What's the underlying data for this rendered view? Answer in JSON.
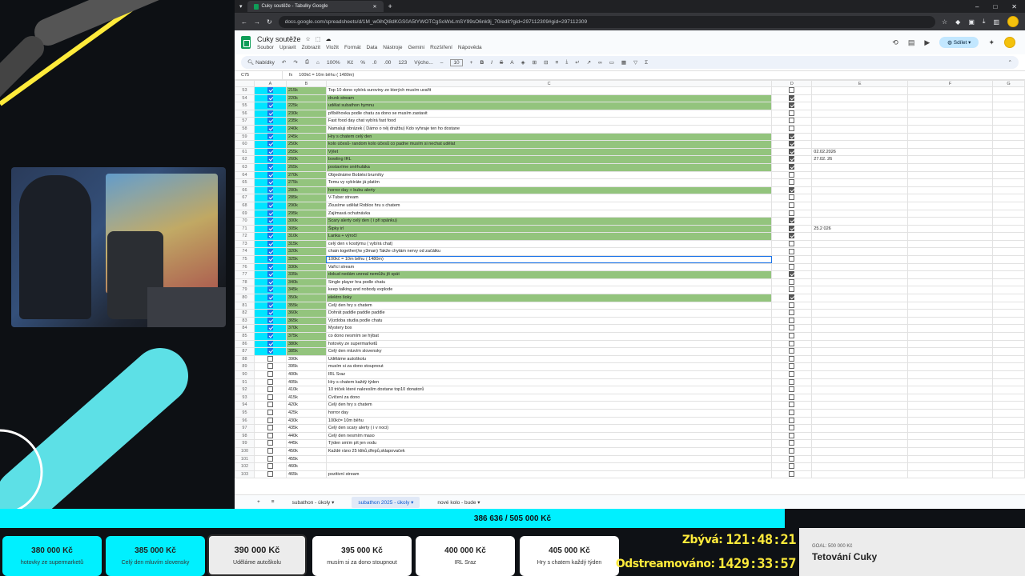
{
  "browser": {
    "tab_title": "Cuky soutěže - Tabulky Google",
    "url": "docs.google.com/spreadsheets/d/1M_w0ihQl8dKGS0A5tYWOTCgSoWxLmSY99sO6nk9j_70/edit?gid=297112309#gid=297112309"
  },
  "sheet": {
    "title": "Cuky soutěže",
    "menus": [
      "Soubor",
      "Upravit",
      "Zobrazit",
      "Vložit",
      "Formát",
      "Data",
      "Nástroje",
      "Gemini",
      "Rozšíření",
      "Nápověda"
    ],
    "share_label": "Sdílet",
    "toolbar": {
      "search": "Nabídky",
      "zoom": "100%",
      "currency": "Kč",
      "percent": "%",
      "decimals": ".0",
      "decimals2": ".00",
      "numfmt": "123",
      "font": "Výcho...",
      "font_size": "10"
    },
    "namebox": "C75",
    "formula": "100kč = 10m běhu ( 1480m)",
    "columns": [
      "",
      "A",
      "B",
      "C",
      "D",
      "E",
      "F",
      "G"
    ],
    "rows": [
      {
        "n": "53",
        "a": true,
        "b": "215k",
        "c": "Top 10 dono vybírá suroviny ze kterých musím uvařit",
        "g": false,
        "d": false,
        "e": ""
      },
      {
        "n": "54",
        "a": true,
        "b": "220k",
        "c": "drunk stream",
        "g": true,
        "d": true,
        "e": ""
      },
      {
        "n": "55",
        "a": true,
        "b": "225k",
        "c": "udělat subathon hymnu",
        "g": true,
        "d": true,
        "e": ""
      },
      {
        "n": "56",
        "a": true,
        "b": "230k",
        "c": "příběhovka podle chatu za dono se musím zastavit",
        "g": false,
        "d": false,
        "e": ""
      },
      {
        "n": "57",
        "a": true,
        "b": "235k",
        "c": "Fast food day chat vybírá fast food",
        "g": false,
        "d": false,
        "e": ""
      },
      {
        "n": "58",
        "a": true,
        "b": "240k",
        "c": "Namaluji obrázek ( Dámo o něj dražbu) Kdo vyhraje ten ho dostane",
        "g": false,
        "d": false,
        "e": ""
      },
      {
        "n": "59",
        "a": true,
        "b": "245k",
        "c": "Hry s chatem celý den",
        "g": true,
        "d": true,
        "e": ""
      },
      {
        "n": "60",
        "a": true,
        "b": "250k",
        "c": "kolo účesů- random kolo účesů co padne musím si nechat udělat",
        "g": true,
        "d": true,
        "e": ""
      },
      {
        "n": "61",
        "a": true,
        "b": "255k",
        "c": "Výlet",
        "g": true,
        "d": true,
        "e": "02.02.2026"
      },
      {
        "n": "62",
        "a": true,
        "b": "260k",
        "c": "bowling IRL",
        "g": true,
        "d": true,
        "e": "27.02. 26"
      },
      {
        "n": "63",
        "a": true,
        "b": "265k",
        "c": "postavíme sněhuláka",
        "g": true,
        "d": true,
        "e": ""
      },
      {
        "n": "64",
        "a": true,
        "b": "270k",
        "c": "Objednáme Bobiési brumíky",
        "g": false,
        "d": false,
        "e": ""
      },
      {
        "n": "65",
        "a": true,
        "b": "275k",
        "c": "Temu vy vybíráte já platím",
        "g": false,
        "d": false,
        "e": ""
      },
      {
        "n": "66",
        "a": true,
        "b": "280k",
        "c": "horror day + bubu alerty",
        "g": true,
        "d": true,
        "e": ""
      },
      {
        "n": "67",
        "a": true,
        "b": "285k",
        "c": "V-Tuber stream",
        "g": false,
        "d": false,
        "e": ""
      },
      {
        "n": "68",
        "a": true,
        "b": "290k",
        "c": "Zkusíme udělat Roblox hru s chatem",
        "g": false,
        "d": false,
        "e": ""
      },
      {
        "n": "69",
        "a": true,
        "b": "295k",
        "c": "Zajímavá ochutnávka",
        "g": false,
        "d": false,
        "e": ""
      },
      {
        "n": "70",
        "a": true,
        "b": "300k",
        "c": "Scary alerty celý den ( i při spánku)",
        "g": true,
        "d": true,
        "e": ""
      },
      {
        "n": "71",
        "a": true,
        "b": "305k",
        "c": "Šipky irl",
        "g": true,
        "d": true,
        "e": "25.2 026"
      },
      {
        "n": "72",
        "a": true,
        "b": "310k",
        "c": "Lanka + výročí",
        "g": true,
        "d": true,
        "e": ""
      },
      {
        "n": "73",
        "a": true,
        "b": "315k",
        "c": "celý den v kostýmu ( vybírá chat)",
        "g": false,
        "d": false,
        "e": ""
      },
      {
        "n": "74",
        "a": true,
        "b": "320k",
        "c": "chain together(/w y3man) Takže chytám nervy od začátku",
        "g": false,
        "d": false,
        "e": ""
      },
      {
        "n": "75",
        "a": true,
        "b": "325k",
        "c": "100kč = 10m běhu ( 1480m)",
        "g": false,
        "d": false,
        "e": "",
        "sel": true
      },
      {
        "n": "76",
        "a": true,
        "b": "330k",
        "c": "Vařící stream",
        "g": false,
        "d": false,
        "e": ""
      },
      {
        "n": "77",
        "a": true,
        "b": "335k",
        "c": "dokud nedám unreal nemůžu jít spát",
        "g": true,
        "d": true,
        "e": ""
      },
      {
        "n": "78",
        "a": true,
        "b": "340k",
        "c": "Single player hra podle chatu",
        "g": false,
        "d": false,
        "e": ""
      },
      {
        "n": "79",
        "a": true,
        "b": "345k",
        "c": "keep talking and nobody explode",
        "g": false,
        "d": false,
        "e": ""
      },
      {
        "n": "80",
        "a": true,
        "b": "350k",
        "c": "elektro šoky",
        "g": true,
        "d": true,
        "e": ""
      },
      {
        "n": "81",
        "a": true,
        "b": "355k",
        "c": "Celý den hry s chatem",
        "g": false,
        "d": false,
        "e": ""
      },
      {
        "n": "82",
        "a": true,
        "b": "360k",
        "c": "Dohrát paddle paddle paddle",
        "g": false,
        "d": false,
        "e": ""
      },
      {
        "n": "83",
        "a": true,
        "b": "365k",
        "c": "Výzdoba studia podle chatu",
        "g": false,
        "d": false,
        "e": ""
      },
      {
        "n": "84",
        "a": true,
        "b": "370k",
        "c": "Mystery box",
        "g": false,
        "d": false,
        "e": ""
      },
      {
        "n": "85",
        "a": true,
        "b": "375k",
        "c": "co dono nesmím se hýbat",
        "g": false,
        "d": false,
        "e": ""
      },
      {
        "n": "86",
        "a": true,
        "b": "380k",
        "c": "hotovky ze supermarketů",
        "g": false,
        "d": false,
        "e": ""
      },
      {
        "n": "87",
        "a": true,
        "b": "385k",
        "c": "Celý den mluvím slovensky",
        "g": false,
        "d": false,
        "e": ""
      },
      {
        "n": "88",
        "a": false,
        "b": "390k",
        "c": "Uděláme autoškolu",
        "g": false,
        "d": false,
        "e": ""
      },
      {
        "n": "89",
        "a": false,
        "b": "395k",
        "c": "musím si za dono stoupnout",
        "g": false,
        "d": false,
        "e": ""
      },
      {
        "n": "90",
        "a": false,
        "b": "400k",
        "c": "IRL Sraz",
        "g": false,
        "d": false,
        "e": ""
      },
      {
        "n": "91",
        "a": false,
        "b": "405k",
        "c": "Hry s chatem každý týden",
        "g": false,
        "d": false,
        "e": ""
      },
      {
        "n": "92",
        "a": false,
        "b": "410k",
        "c": "10 triček které nakreslím dostane top10 donatorů",
        "g": false,
        "d": false,
        "e": ""
      },
      {
        "n": "93",
        "a": false,
        "b": "415k",
        "c": "Cvičení za dono",
        "g": false,
        "d": false,
        "e": ""
      },
      {
        "n": "94",
        "a": false,
        "b": "420k",
        "c": "Celý den hry s chatem",
        "g": false,
        "d": false,
        "e": ""
      },
      {
        "n": "95",
        "a": false,
        "b": "425k",
        "c": "horror day",
        "g": false,
        "d": false,
        "e": ""
      },
      {
        "n": "96",
        "a": false,
        "b": "430k",
        "c": "100kč= 10m běhu",
        "g": false,
        "d": false,
        "e": ""
      },
      {
        "n": "97",
        "a": false,
        "b": "435k",
        "c": "Celý den scary alerty ( i v noci)",
        "g": false,
        "d": false,
        "e": ""
      },
      {
        "n": "98",
        "a": false,
        "b": "440k",
        "c": "Celý den nesmím maso",
        "g": false,
        "d": false,
        "e": ""
      },
      {
        "n": "99",
        "a": false,
        "b": "445k",
        "c": "Týden smím pít jen vodu",
        "g": false,
        "d": false,
        "e": ""
      },
      {
        "n": "100",
        "a": false,
        "b": "450k",
        "c": "Každé ráno 25 kliků,dřepů,sklapovaček",
        "g": false,
        "d": false,
        "e": ""
      },
      {
        "n": "101",
        "a": false,
        "b": "455k",
        "c": "",
        "g": false,
        "d": false,
        "e": ""
      },
      {
        "n": "102",
        "a": false,
        "b": "460k",
        "c": "",
        "g": false,
        "d": false,
        "e": ""
      },
      {
        "n": "103",
        "a": false,
        "b": "465k",
        "c": "pozitivní stream",
        "g": false,
        "d": false,
        "e": ""
      }
    ],
    "tabs": [
      "subathon - úkoly",
      "subathon 2025 - úkoly",
      "nové kolo - bude"
    ],
    "active_tab": 1
  },
  "stream": {
    "progress_text": "386 636 / 505 000 Kč",
    "progress_fraction": 0.7656,
    "goals": [
      {
        "amount": "380 000 Kč",
        "label": "hotovky ze supermarketů",
        "state": "done"
      },
      {
        "amount": "385 000 Kč",
        "label": "Celý den mluvím slovensky",
        "state": "done"
      },
      {
        "amount": "390 000 Kč",
        "label": "Uděláme autoškolu",
        "state": "current"
      },
      {
        "amount": "395 000 Kč",
        "label": "musím si za dono stoupnout",
        "state": "todo"
      },
      {
        "amount": "400 000 Kč",
        "label": "IRL Sraz",
        "state": "todo"
      },
      {
        "amount": "405 000 Kč",
        "label": "Hry s chatem každý týden",
        "state": "todo"
      }
    ],
    "remaining_label": "Zbývá:",
    "remaining_value": "121:48:21",
    "streamed_label": "Odstreamováno:",
    "streamed_value": "1429:33:57",
    "next_goal_small": "GOAL: 500 000 Kč",
    "next_goal_title": "Tetování Cuky"
  },
  "colors": {
    "accent": "#00f0ff",
    "green_fill": "#93c47d",
    "timer": "#ffeb3b"
  }
}
